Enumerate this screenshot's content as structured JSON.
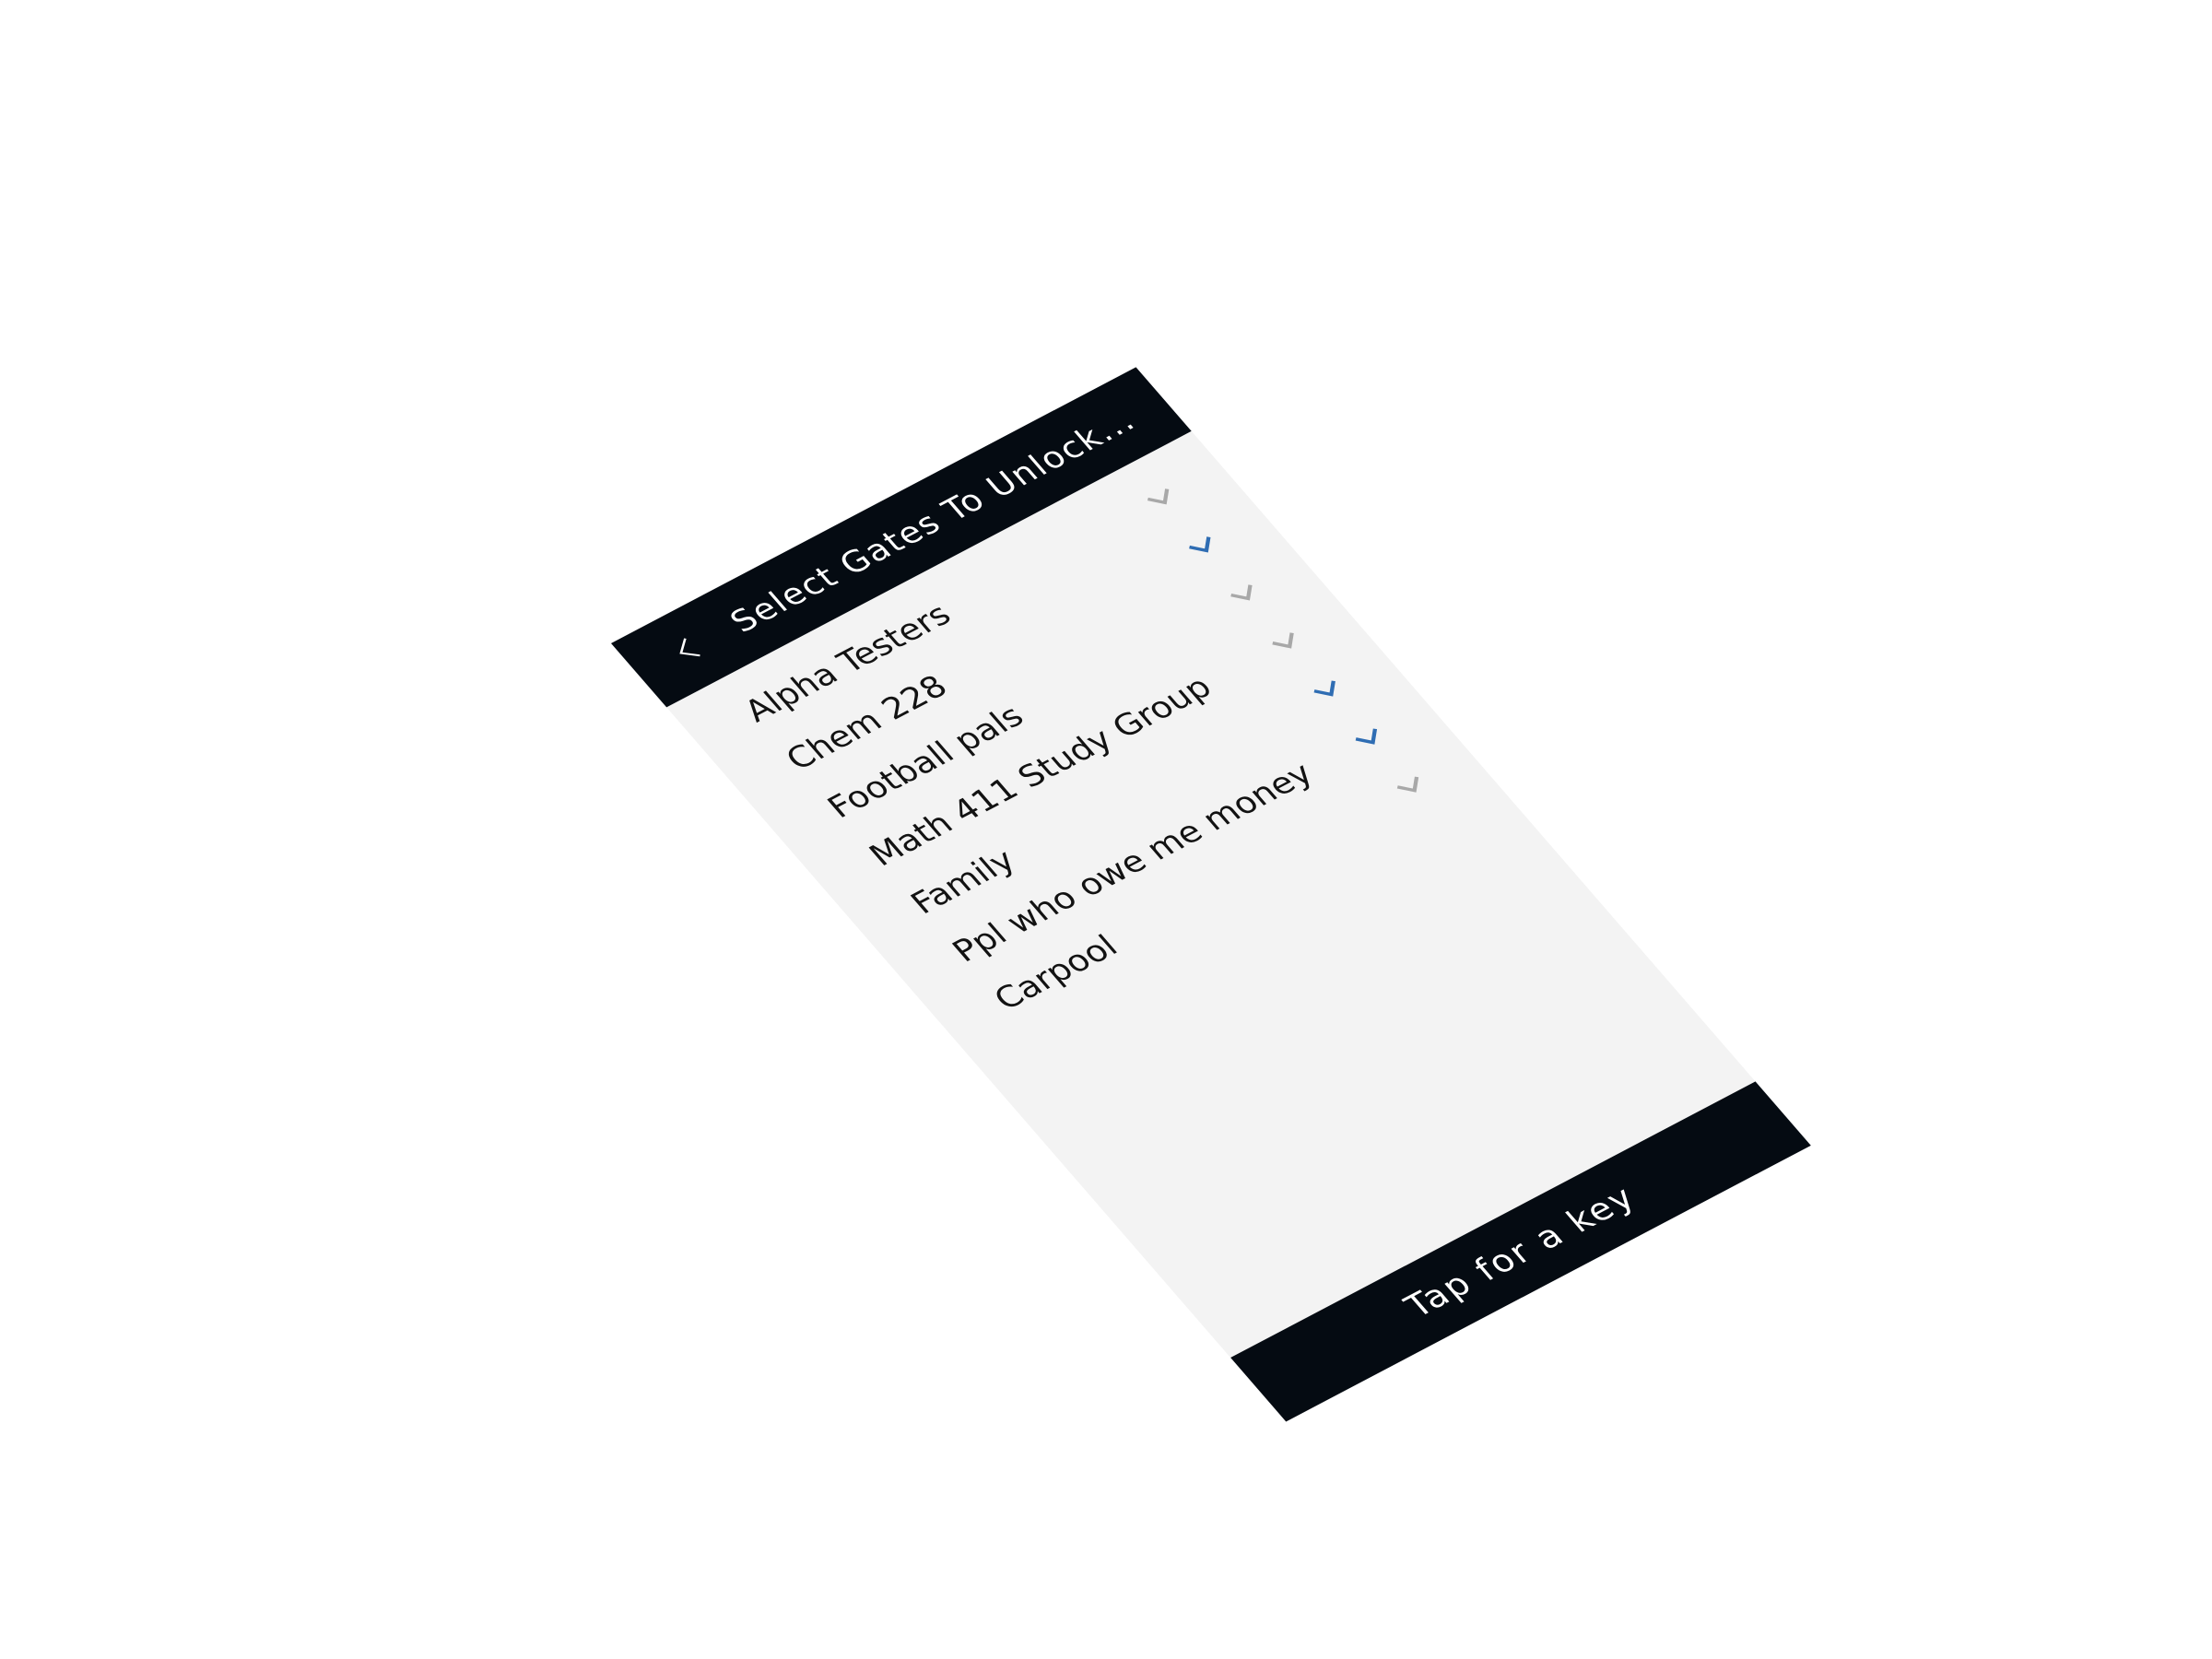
{
  "header": {
    "title": "Select Gates To Unlock...",
    "back_icon": "chevron-left-icon"
  },
  "gates": [
    {
      "label": "Alpha Testers",
      "selected": false
    },
    {
      "label": "Chem 228",
      "selected": true
    },
    {
      "label": "Football pals",
      "selected": false
    },
    {
      "label": "Math 411 Study Group",
      "selected": false
    },
    {
      "label": "Family",
      "selected": true
    },
    {
      "label": "Ppl who owe me money",
      "selected": true
    },
    {
      "label": "Carpool",
      "selected": false
    }
  ],
  "footer": {
    "label": "Tap for a key"
  },
  "colors": {
    "bar_background": "#050b12",
    "list_background": "#f3f3f3",
    "check_selected": "#2f6db3",
    "check_unselected": "#a8a8a8",
    "page_background": "#ffffff"
  }
}
